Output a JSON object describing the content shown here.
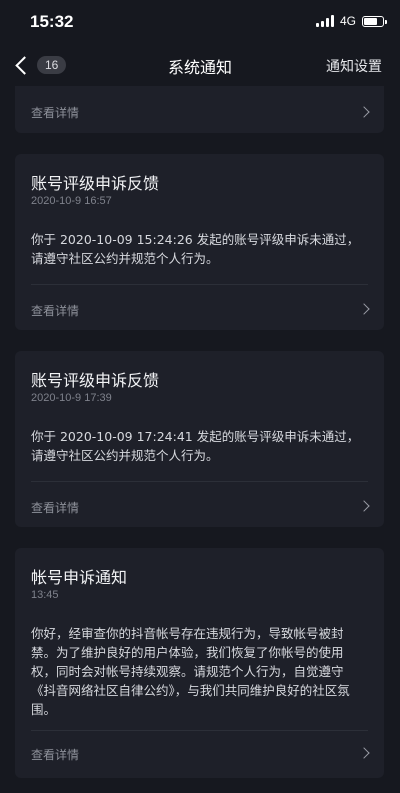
{
  "status_bar": {
    "time": "15:32",
    "network": "4G"
  },
  "nav": {
    "back_count": "16",
    "title": "系统通知",
    "settings_label": "通知设置"
  },
  "top_partial": {
    "detail_label": "查看详情"
  },
  "notifications": [
    {
      "title": "账号评级申诉反馈",
      "date": "2020-10-9 16:57",
      "body": "你于 2020-10-09 15:24:26 发起的账号评级申诉未通过，请遵守社区公约并规范个人行为。",
      "detail_label": "查看详情"
    },
    {
      "title": "账号评级申诉反馈",
      "date": "2020-10-9 17:39",
      "body": "你于 2020-10-09 17:24:41 发起的账号评级申诉未通过，请遵守社区公约并规范个人行为。",
      "detail_label": "查看详情"
    },
    {
      "title": "帐号申诉通知",
      "date": "13:45",
      "body": "你好，经审查你的抖音帐号存在违规行为，导致帐号被封禁。为了维护良好的用户体验，我们恢复了你帐号的使用权，同时会对帐号持续观察。请规范个人行为，自觉遵守《抖音网络社区自律公约》，与我们共同维护良好的社区氛围。",
      "detail_label": "查看详情"
    }
  ]
}
